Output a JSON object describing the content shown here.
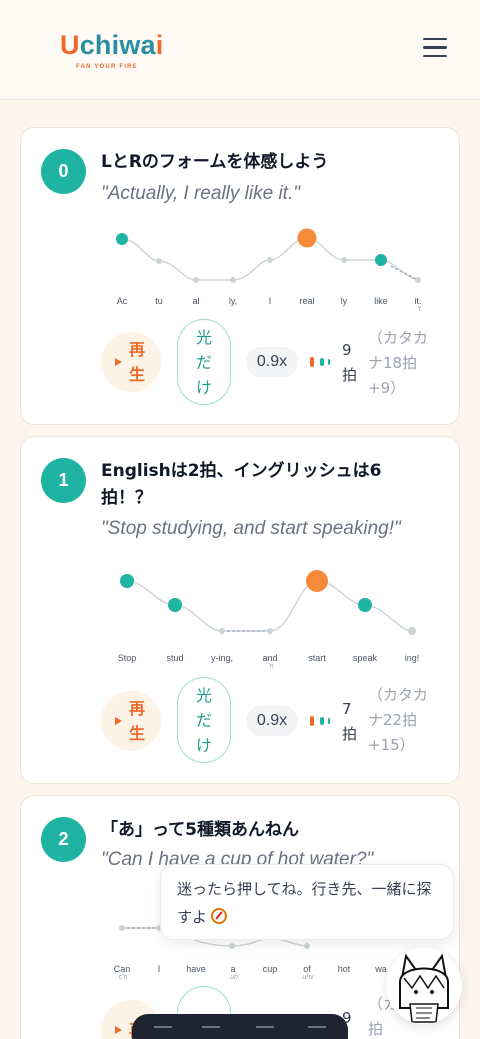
{
  "header": {
    "logo_main": "chiwa",
    "logo_u": "U",
    "logo_i": "i",
    "tagline": "FAN YOUR FIRE",
    "menu_icon": "hamburger-icon"
  },
  "colors": {
    "accent_teal": "#1fb3a4",
    "accent_orange": "#ee6a2a",
    "background": "#fdf6ec"
  },
  "lessons": [
    {
      "number": "0",
      "title": "LとRのフォームを体感しよう",
      "quote": "\"Actually, I really like it.\"",
      "words": [
        "Ac",
        "tu",
        "al",
        "ly,",
        "I",
        "real",
        "ly",
        "like",
        "it."
      ],
      "subs": [
        "",
        "",
        "",
        "",
        "",
        "",
        "",
        "",
        "'t"
      ],
      "play_label": "再生",
      "light_label": "光だけ",
      "speed": "0.9x",
      "beats": "9拍",
      "katakana": "（カタカナ18拍+9）"
    },
    {
      "number": "1",
      "title": "Englishは2拍、イングリッシュは6拍！？",
      "quote": "\"Stop studying, and start speaking!\"",
      "words": [
        "Stop",
        "stud",
        "y-ing,",
        "and",
        "start",
        "speak",
        "ing!"
      ],
      "subs": [
        "",
        "",
        "",
        "'n",
        "",
        "",
        ""
      ],
      "play_label": "再生",
      "light_label": "光だけ",
      "speed": "0.9x",
      "beats": "7拍",
      "katakana": "（カタカナ22拍+15）"
    },
    {
      "number": "2",
      "title": "「あ」って5種類あんねん",
      "quote": "\"Can I have a cup of hot water?\"",
      "words": [
        "Can",
        "I",
        "have",
        "a",
        "cup",
        "of",
        "hot",
        "wa"
      ],
      "subs": [
        "c'n",
        "",
        "",
        "uh",
        "",
        "uhv",
        "",
        ""
      ],
      "play_label": "再",
      "light_label": "光",
      "beats": "9",
      "katakana": "（カナ19拍"
    }
  ],
  "tooltip": {
    "text": "迷ったら押してね。行き先、一緒に探すよ",
    "icon": "compass-icon"
  },
  "mascot": {
    "icon": "mascot-cat-girl-icon"
  }
}
